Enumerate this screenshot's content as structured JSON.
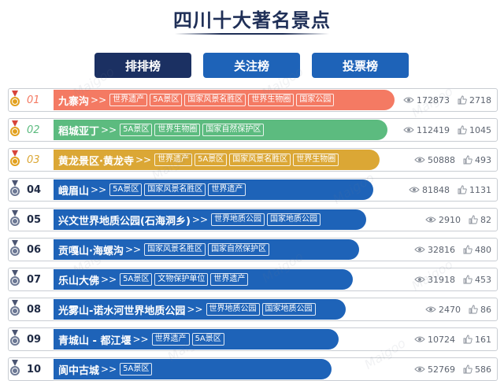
{
  "page": {
    "title": "四川十大著名景点"
  },
  "tabs": [
    {
      "label": "排排榜",
      "active": true
    },
    {
      "label": "关注榜",
      "active": false
    },
    {
      "label": "投票榜",
      "active": false
    }
  ],
  "arrows": ">>",
  "watermark": "Maigoo",
  "colors": {
    "rank1": "#f47a63",
    "rank2": "#5cbb7f",
    "rank3": "#dba735",
    "rest": "#1e63b8",
    "title": "#1f2f57"
  },
  "rows": [
    {
      "rank": "01",
      "name": "九寨沟",
      "tags": [
        "世界遗产",
        "5A景区",
        "国家风景名胜区",
        "世界生物圈",
        "国家公园"
      ],
      "views": "172873",
      "likes": "2718",
      "medal": "gold"
    },
    {
      "rank": "02",
      "name": "稻城亚丁",
      "tags": [
        "5A景区",
        "世界生物圈",
        "国家自然保护区"
      ],
      "views": "112419",
      "likes": "1045",
      "medal": "gold"
    },
    {
      "rank": "03",
      "name": "黄龙景区·黄龙寺",
      "tags": [
        "世界遗产",
        "5A景区",
        "国家风景名胜区",
        "世界生物圈"
      ],
      "views": "50888",
      "likes": "493",
      "medal": "gold"
    },
    {
      "rank": "04",
      "name": "峨眉山",
      "tags": [
        "5A景区",
        "国家风景名胜区",
        "世界遗产"
      ],
      "views": "81848",
      "likes": "1131",
      "medal": "silver"
    },
    {
      "rank": "05",
      "name": "兴文世界地质公园(石海洞乡)",
      "tags": [
        "世界地质公园",
        "国家地质公园"
      ],
      "views": "2910",
      "likes": "82",
      "medal": "silver"
    },
    {
      "rank": "06",
      "name": "贡嘎山·海螺沟",
      "tags": [
        "国家风景名胜区",
        "国家自然保护区"
      ],
      "views": "32816",
      "likes": "480",
      "medal": "silver"
    },
    {
      "rank": "07",
      "name": "乐山大佛",
      "tags": [
        "5A景区",
        "文物保护单位",
        "世界遗产"
      ],
      "views": "31918",
      "likes": "453",
      "medal": "silver"
    },
    {
      "rank": "08",
      "name": "光雾山-诺水河世界地质公园",
      "tags": [
        "世界地质公园",
        "国家地质公园"
      ],
      "views": "2470",
      "likes": "86",
      "medal": "silver"
    },
    {
      "rank": "09",
      "name": "青城山 - 都江堰",
      "tags": [
        "世界遗产",
        "5A景区"
      ],
      "views": "10724",
      "likes": "161",
      "medal": "silver"
    },
    {
      "rank": "10",
      "name": "阆中古城",
      "tags": [
        "5A景区"
      ],
      "views": "52769",
      "likes": "586",
      "medal": "silver"
    }
  ]
}
